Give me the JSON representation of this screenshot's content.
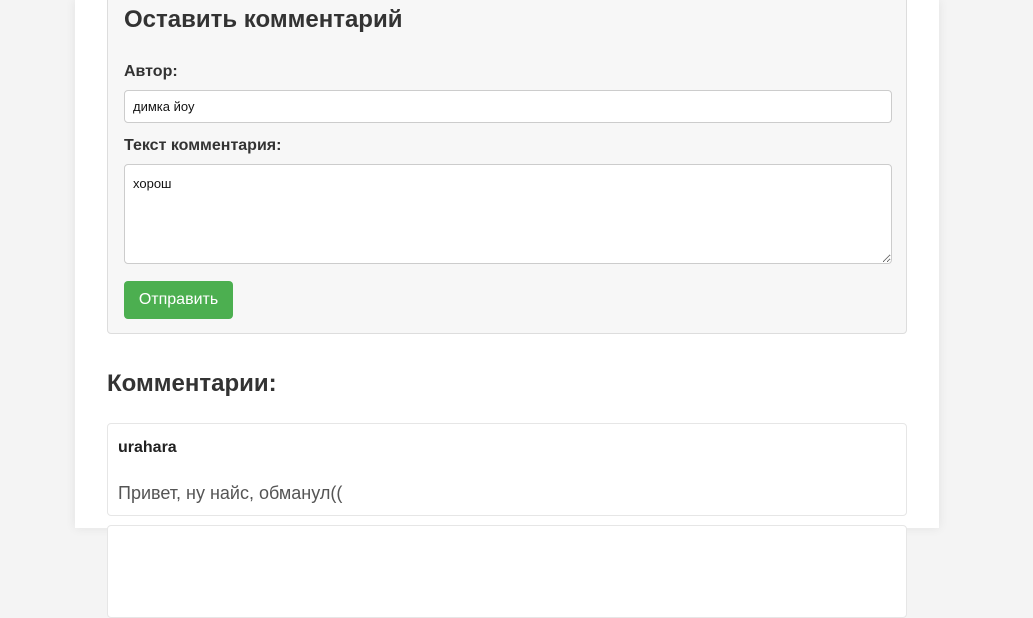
{
  "form": {
    "title": "Оставить комментарий",
    "author_label": "Автор:",
    "author_value": "димка йоу",
    "text_label": "Текст комментария:",
    "text_value": "хорош",
    "submit_label": "Отправить",
    "submit_color": "#4caf50"
  },
  "comments": {
    "title": "Комментарии:",
    "items": [
      {
        "author": "urahara",
        "text": "Привет, ну найс, обманул(("
      }
    ]
  }
}
